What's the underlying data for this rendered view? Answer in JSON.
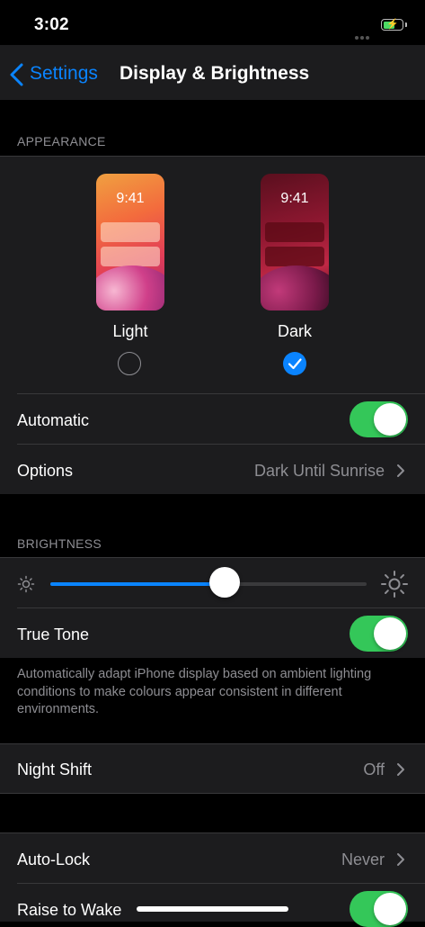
{
  "status_bar": {
    "time": "3:02",
    "battery_level": 0.55,
    "charging": true
  },
  "nav": {
    "back_label": "Settings",
    "title": "Display & Brightness"
  },
  "appearance": {
    "header": "APPEARANCE",
    "options": [
      {
        "label": "Light",
        "preview_time": "9:41",
        "selected": false
      },
      {
        "label": "Dark",
        "preview_time": "9:41",
        "selected": true
      }
    ],
    "automatic": {
      "label": "Automatic",
      "on": true
    },
    "options_row": {
      "label": "Options",
      "value": "Dark Until Sunrise"
    }
  },
  "brightness": {
    "header": "BRIGHTNESS",
    "level": 0.55,
    "true_tone": {
      "label": "True Tone",
      "on": true
    },
    "footer": "Automatically adapt iPhone display based on ambient lighting conditions to make colours appear consistent in different environments."
  },
  "night_shift": {
    "label": "Night Shift",
    "value": "Off"
  },
  "auto_lock": {
    "label": "Auto-Lock",
    "value": "Never"
  },
  "raise_to_wake": {
    "label": "Raise to Wake",
    "on": true
  },
  "colors": {
    "accent": "#0a84ff",
    "toggle_on": "#34c759",
    "background": "#000000",
    "cell": "#1c1c1e",
    "secondary_text": "#8e8e93"
  }
}
